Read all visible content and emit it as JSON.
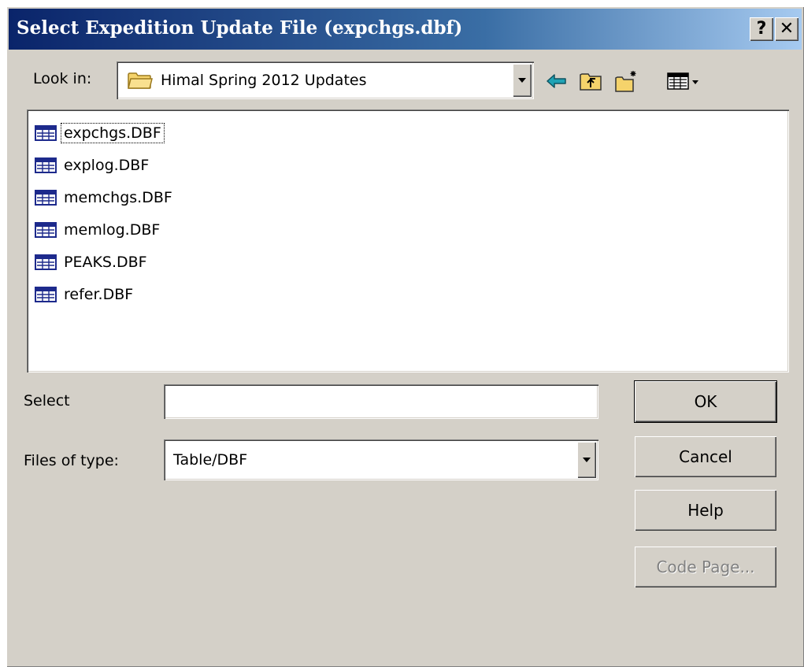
{
  "dialog": {
    "title": "Select Expedition Update File (expchgs.dbf)",
    "help_glyph": "?",
    "close_glyph": "✕"
  },
  "look_in": {
    "label": "Look in:",
    "value": "Himal Spring 2012 Updates",
    "icon": "folder-icon"
  },
  "toolbar": {
    "icons": [
      "back-arrow-icon",
      "up-folder-icon",
      "new-folder-icon",
      "view-menu-icon"
    ]
  },
  "files": [
    {
      "name": "expchgs.DBF",
      "icon": "table-file-icon",
      "focused": true
    },
    {
      "name": "explog.DBF",
      "icon": "table-file-icon"
    },
    {
      "name": "memchgs.DBF",
      "icon": "table-file-icon"
    },
    {
      "name": "memlog.DBF",
      "icon": "table-file-icon"
    },
    {
      "name": "PEAKS.DBF",
      "icon": "table-file-icon"
    },
    {
      "name": "refer.DBF",
      "icon": "table-file-icon"
    }
  ],
  "select": {
    "label": "Select",
    "value": ""
  },
  "files_of_type": {
    "label": "Files of type:",
    "value": "Table/DBF"
  },
  "buttons": {
    "ok": "OK",
    "cancel": "Cancel",
    "help": "Help",
    "code_page": "Code Page..."
  },
  "colors": {
    "title_bar_start": "#0a246a",
    "title_bar_end": "#a6caf0",
    "dialog_face": "#d4d0c8",
    "arrow_icon": "#1fa3b5"
  }
}
